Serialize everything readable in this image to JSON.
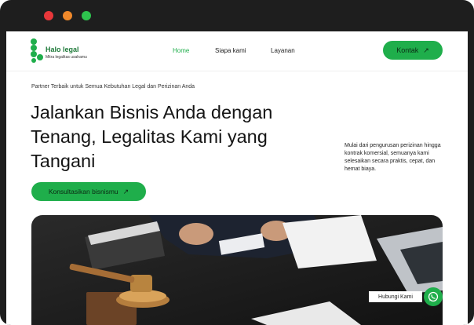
{
  "browser": {
    "controls": [
      {
        "name": "close",
        "color": "#e8373a"
      },
      {
        "name": "minimize",
        "color": "#f0892b"
      },
      {
        "name": "maximize",
        "color": "#2ec24e"
      }
    ]
  },
  "colors": {
    "accent": "#1fae4b",
    "logo_text": "#1f7a3a",
    "frame": "#1e1e1e"
  },
  "header": {
    "logo_name": "Halo legal",
    "logo_tagline": "Mitra legalitas usahamu",
    "nav": [
      "Home",
      "Siapa kami",
      "Layanan"
    ],
    "active_nav": "Home",
    "contact_label": "Kontak",
    "contact_icon": "arrow-up-right-icon"
  },
  "hero": {
    "tagline": "Partner Terbaik untuk Semua Kebutuhan Legal dan Perizinan Anda",
    "headline": "Jalankan Bisnis Anda dengan Tenang, Legalitas Kami yang Tangani",
    "description": "Mulai dari pengurusan perizinan hingga kontrak komersial, semuanya kami selesaikan secara praktis, cepat, dan hemat biaya.",
    "cta_label": "Konsultasikan bisnismu",
    "cta_icon": "arrow-up-right-icon"
  },
  "floating_contact": {
    "label": "Hubungi Kami",
    "icon": "whatsapp-icon"
  }
}
